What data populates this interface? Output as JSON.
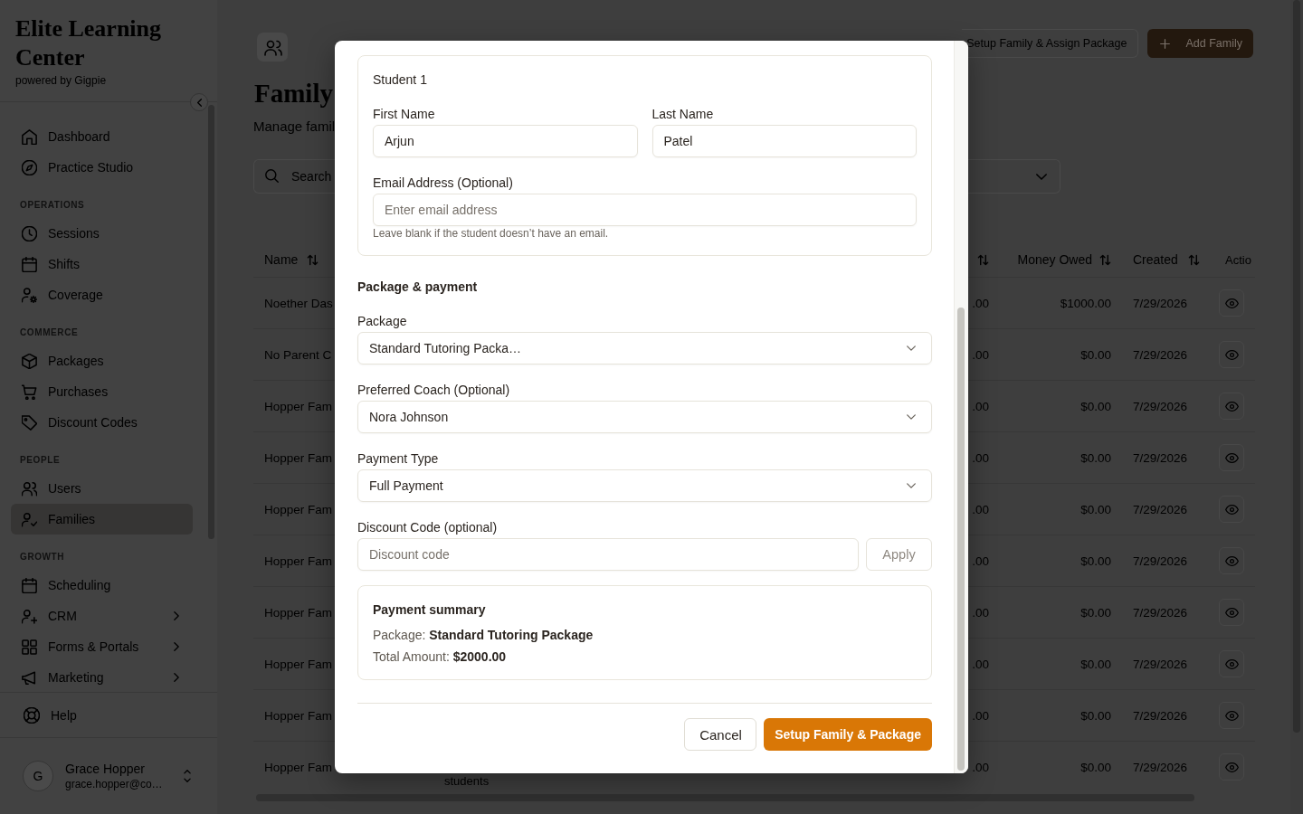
{
  "sidebar": {
    "brand": "Elite Learning Center",
    "tagline": "powered by Gigpie",
    "sections": [
      {
        "items": [
          {
            "label": "Dashboard",
            "selected": false,
            "expandable": false
          },
          {
            "label": "Practice Studio",
            "selected": false,
            "expandable": false
          }
        ]
      },
      {
        "heading": "OPERATIONS",
        "items": [
          {
            "label": "Sessions",
            "selected": false,
            "expandable": false
          },
          {
            "label": "Shifts",
            "selected": false,
            "expandable": false
          },
          {
            "label": "Coverage",
            "selected": false,
            "expandable": false
          }
        ]
      },
      {
        "heading": "COMMERCE",
        "items": [
          {
            "label": "Packages",
            "selected": false,
            "expandable": false
          },
          {
            "label": "Purchases",
            "selected": false,
            "expandable": false
          },
          {
            "label": "Discount Codes",
            "selected": false,
            "expandable": false
          }
        ]
      },
      {
        "heading": "PEOPLE",
        "items": [
          {
            "label": "Users",
            "selected": false,
            "expandable": false
          },
          {
            "label": "Families",
            "selected": true,
            "expandable": false
          }
        ]
      },
      {
        "heading": "GROWTH",
        "items": [
          {
            "label": "Scheduling",
            "selected": false,
            "expandable": false
          },
          {
            "label": "CRM",
            "selected": false,
            "expandable": true
          },
          {
            "label": "Forms & Portals",
            "selected": false,
            "expandable": true
          },
          {
            "label": "Marketing",
            "selected": false,
            "expandable": true
          }
        ]
      }
    ],
    "help": {
      "label": "Help"
    },
    "user": {
      "initial": "G",
      "name": "Grace Hopper",
      "email": "grace.hopper@co…"
    }
  },
  "header": {
    "title": "Family",
    "subtitle": "Manage famil",
    "actions": [
      {
        "label": "Setup Family & Assign Package",
        "kind": "outline"
      },
      {
        "label": "Add Family",
        "kind": "primary"
      }
    ]
  },
  "toolbar": {
    "search": {
      "placeholder": "Search"
    }
  },
  "table": {
    "columns": [
      {
        "label": "Name",
        "sortable": true
      },
      {
        "sortable": true
      },
      {
        "label": "Money Owed",
        "sortable": true
      },
      {
        "label": "Created",
        "sortable": true
      },
      {
        "label": "Actio",
        "sortable": false
      }
    ],
    "rows": [
      {
        "name": "Noether Das",
        "column_3": ".00",
        "money_owed": "$1000.00",
        "created": "7/29/2026"
      },
      {
        "name": "No Parent C",
        "column_3": ".00",
        "money_owed": "$0.00",
        "created": "7/29/2026"
      },
      {
        "name": "Hopper Fam",
        "column_3": ".00",
        "money_owed": "$0.00",
        "created": "7/29/2026"
      },
      {
        "name": "Hopper Fam",
        "column_3": ".00",
        "money_owed": "$0.00",
        "created": "7/29/2026"
      },
      {
        "name": "Hopper Fam",
        "column_3": ".00",
        "money_owed": "$0.00",
        "created": "7/29/2026"
      },
      {
        "name": "Hopper Fam",
        "column_3": ".00",
        "money_owed": "$0.00",
        "created": "7/29/2026"
      },
      {
        "name": "Hopper Fam",
        "column_3": ".00",
        "money_owed": "$0.00",
        "created": "7/29/2026"
      },
      {
        "name": "Hopper Fam",
        "column_3": ".00",
        "money_owed": "$0.00",
        "created": "7/29/2026"
      },
      {
        "name": "Hopper Fam",
        "column_3": ".00",
        "money_owed": "$0.00",
        "created": "7/29/2026"
      },
      {
        "name": "Hopper Fam",
        "column_2": "students",
        "column_3": ".00",
        "money_owed": "$0.00",
        "created": "7/29/2026"
      }
    ]
  },
  "modal": {
    "student": {
      "heading": "Student 1",
      "name_fields": [
        {
          "label": "First Name",
          "value": "Arjun"
        },
        {
          "label": "Last Name",
          "value": "Patel"
        }
      ],
      "email": {
        "label": "Email Address (Optional)",
        "placeholder": "Enter email address",
        "hint": "Leave blank if the student doesn’t have an email."
      }
    },
    "section_title": "Package & payment",
    "selects": [
      {
        "label": "Package",
        "value": "Standard Tutoring Packa…"
      },
      {
        "label": "Preferred Coach (Optional)",
        "value": "Nora Johnson"
      },
      {
        "label": "Payment Type",
        "value": "Full Payment"
      }
    ],
    "discount": {
      "label": "Discount Code (optional)",
      "placeholder": "Discount code",
      "apply": {
        "label": "Apply",
        "disabled": true
      }
    },
    "summary": {
      "title": "Payment summary",
      "lines": [
        "Package: **Standard Tutoring Package**",
        "Total Amount: **$2000.00**"
      ]
    },
    "buttons": [
      {
        "label": "Cancel",
        "kind": "secondary"
      },
      {
        "label": "Setup Family & Package",
        "kind": "primary"
      }
    ]
  }
}
